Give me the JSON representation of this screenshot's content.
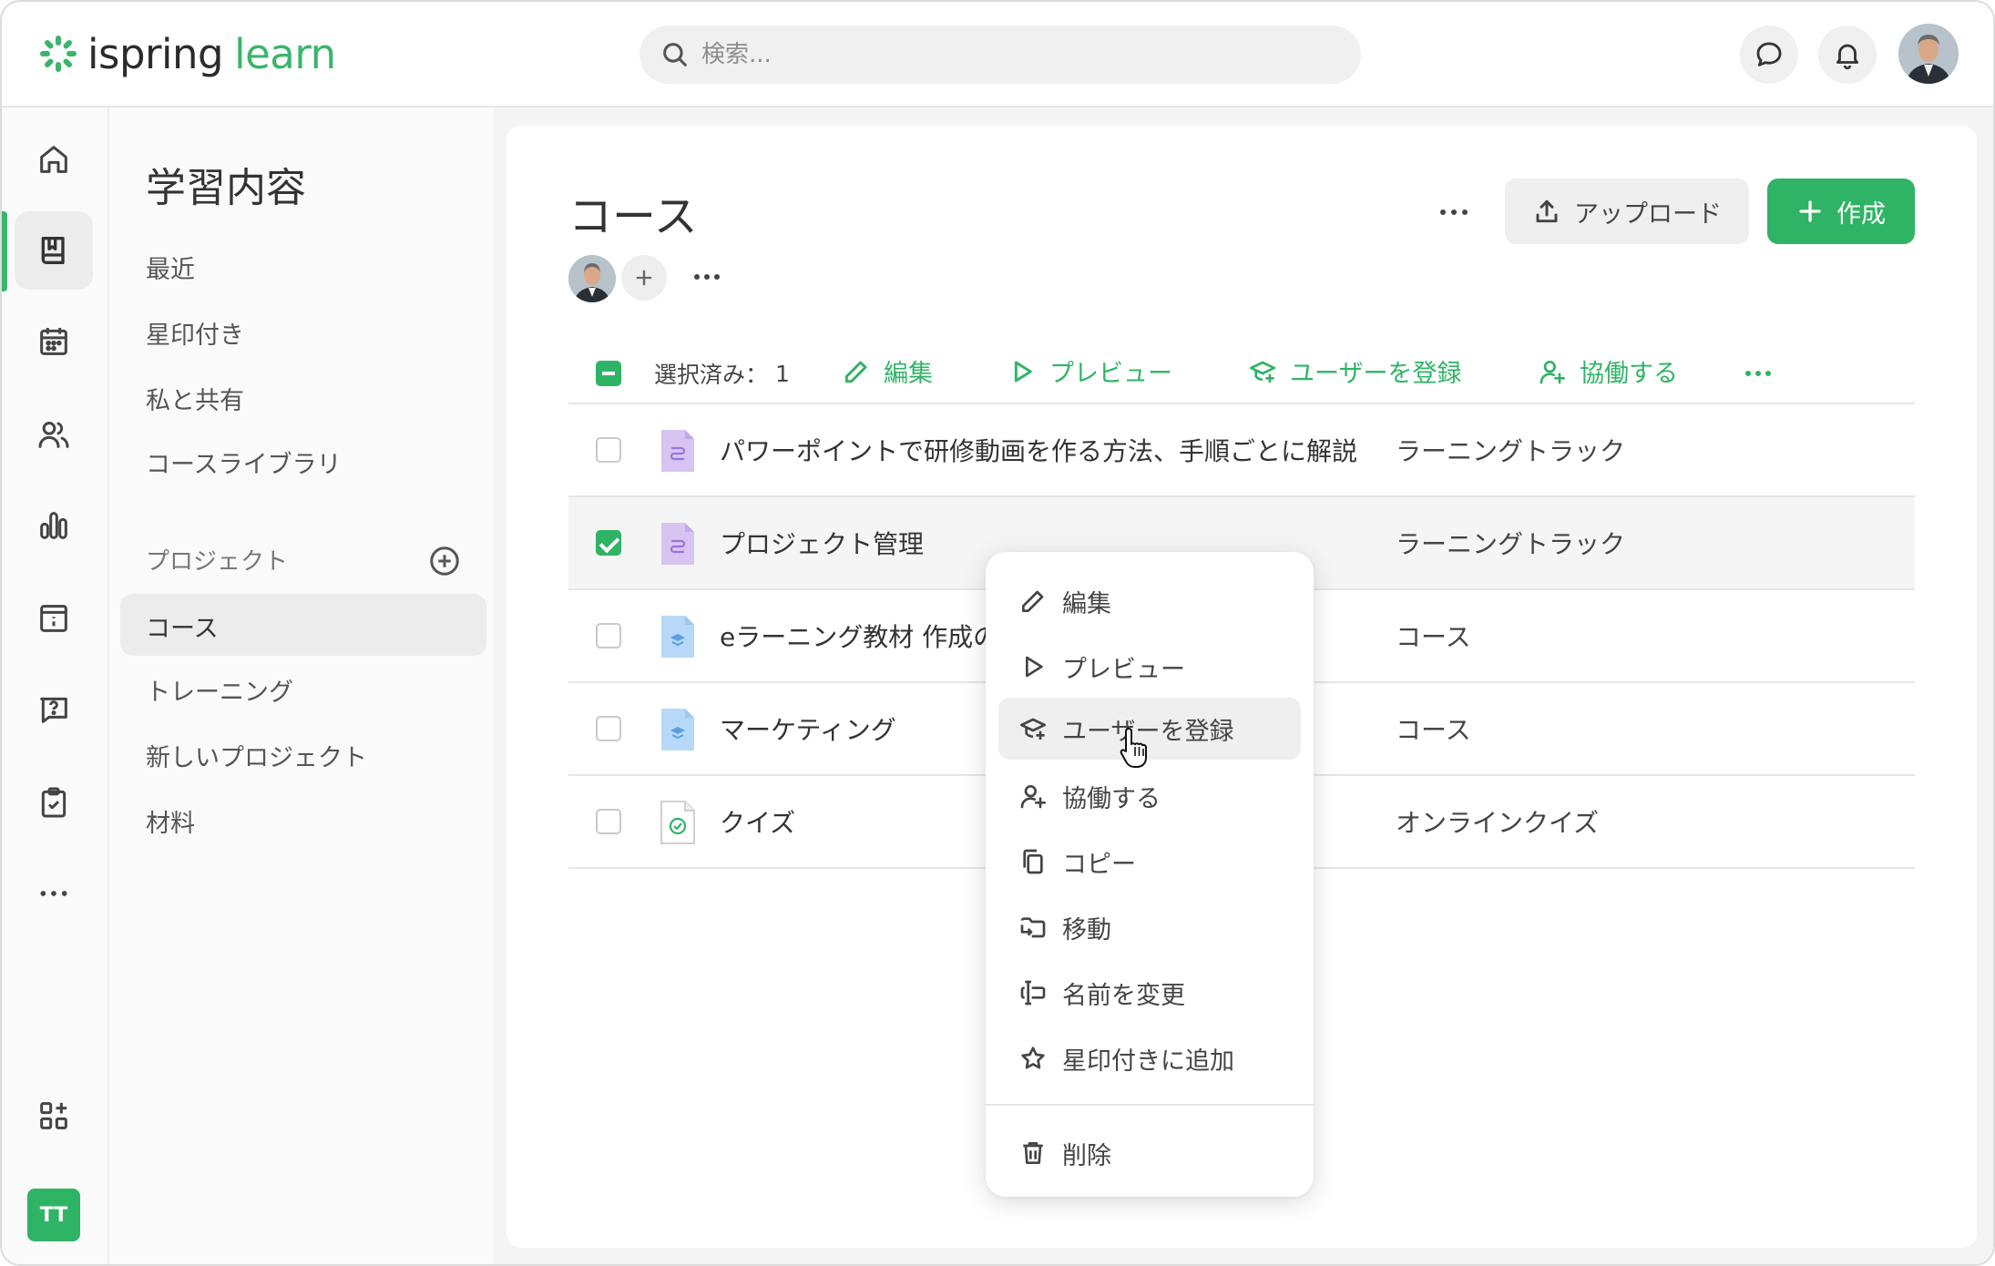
{
  "brand": {
    "name_part1": "ispring",
    "name_part2": "learn",
    "accent": "#2fb466"
  },
  "search": {
    "placeholder": "検索..."
  },
  "header": {
    "chat_icon": "chat-bubble-icon",
    "bell_icon": "bell-icon"
  },
  "rail": {
    "items": [
      "home-icon",
      "book-icon",
      "calendar-icon",
      "users-icon",
      "chart-icon",
      "info-board-icon",
      "help-chat-icon",
      "clipboard-check-icon",
      "more-icon",
      "apps-add-icon"
    ],
    "user_initials": "TT"
  },
  "subnav": {
    "title": "学習内容",
    "items": [
      "最近",
      "星印付き",
      "私と共有",
      "コースライブラリ"
    ],
    "projects_label": "プロジェクト",
    "projects": [
      "コース",
      "トレーニング",
      "新しいプロジェクト",
      "材料"
    ]
  },
  "main": {
    "title": "コース",
    "upload_label": "アップロード",
    "create_label": "作成"
  },
  "toolbar": {
    "selected_label": "選択済み：",
    "selected_count": "1",
    "edit": "編集",
    "preview": "プレビュー",
    "enroll": "ユーザーを登録",
    "collaborate": "協働する"
  },
  "rows": [
    {
      "name": "パワーポイントで研修動画を作る方法、手順ごとに解説",
      "type": "ラーニングトラック",
      "icon": "learning-track-icon",
      "checked": false
    },
    {
      "name": "プロジェクト管理",
      "type": "ラーニングトラック",
      "icon": "learning-track-icon",
      "checked": true
    },
    {
      "name": "eラーニング教材 作成の",
      "type": "コース",
      "icon": "course-icon",
      "checked": false
    },
    {
      "name": "マーケティング",
      "type": "コース",
      "icon": "course-icon",
      "checked": false
    },
    {
      "name": "クイズ",
      "type": "オンラインクイズ",
      "icon": "quiz-icon",
      "checked": false
    }
  ],
  "context_menu": {
    "items": [
      "編集",
      "プレビュー",
      "ユーザーを登録",
      "協働する",
      "コピー",
      "移動",
      "名前を変更",
      "星印付きに追加"
    ],
    "delete": "削除"
  }
}
